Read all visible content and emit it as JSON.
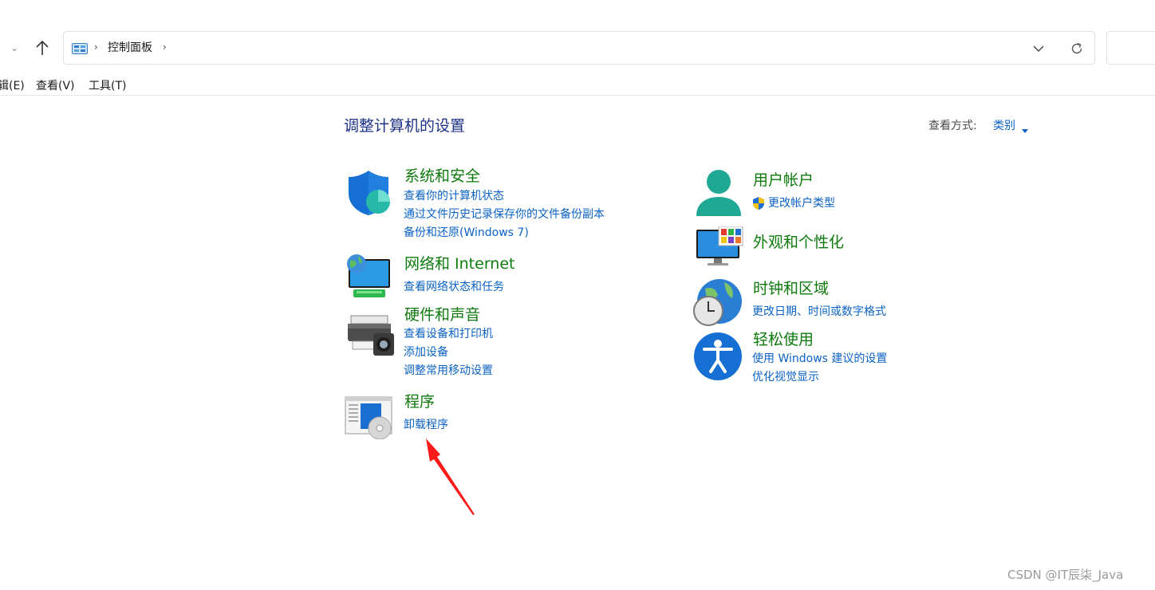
{
  "address_bar": {
    "breadcrumb": "控制面板"
  },
  "menu": {
    "edit": "辑(E)",
    "view": "查看(V)",
    "tools": "工具(T)"
  },
  "header": {
    "title": "调整计算机的设置",
    "view_by_label": "查看方式:",
    "view_by_value": "类别"
  },
  "left_categories": [
    {
      "title": "系统和安全",
      "icon": "shield-icon",
      "links": [
        "查看你的计算机状态",
        "通过文件历史记录保存你的文件备份副本",
        "备份和还原(Windows 7)"
      ]
    },
    {
      "title": "网络和 Internet",
      "icon": "network-globe-icon",
      "links": [
        "查看网络状态和任务"
      ]
    },
    {
      "title": "硬件和声音",
      "icon": "printer-icon",
      "links": [
        "查看设备和打印机",
        "添加设备",
        "调整常用移动设置"
      ]
    },
    {
      "title": "程序",
      "icon": "programs-icon",
      "links": [
        "卸载程序"
      ]
    }
  ],
  "right_categories": [
    {
      "title": "用户帐户",
      "icon": "user-icon",
      "links": [
        "更改帐户类型"
      ]
    },
    {
      "title": "外观和个性化",
      "icon": "monitor-icon",
      "links": []
    },
    {
      "title": "时钟和区域",
      "icon": "clock-globe-icon",
      "links": [
        "更改日期、时间或数字格式"
      ]
    },
    {
      "title": "轻松使用",
      "icon": "accessibility-icon",
      "links": [
        "使用 Windows 建议的设置",
        "优化视觉显示"
      ]
    }
  ],
  "annotation": {
    "arrow_color": "#ff1a1a"
  },
  "watermark": "CSDN @IT辰柒_Java",
  "colors": {
    "category_title": "#0e7a0d",
    "link": "#0b62c4",
    "page_title": "#1e3287"
  }
}
